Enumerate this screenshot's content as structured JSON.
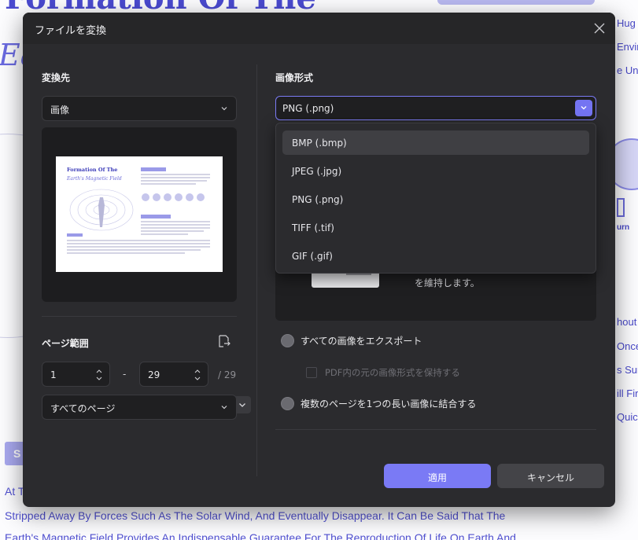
{
  "background": {
    "title": "Formation Of The",
    "italic": "Ea",
    "right_labels": [
      "Hug",
      "Envir",
      "e Uni",
      "hout C",
      "Once",
      "s Surf",
      "ill Fir",
      "Quick"
    ],
    "burn_label": "urn",
    "s_button": "S",
    "lines": [
      "At T",
      "Stripped Away By Forces Such As The Solar Wind, And Eventually Disappear. It Can Be Said That The",
      "Earth's Magnetic Field Provides An Indispensable Guarantee For The Reproduction Of Life On Earth And"
    ]
  },
  "dialog": {
    "title": "ファイルを変換",
    "left": {
      "convert_to_label": "変換先",
      "convert_to_value": "画像",
      "page_range_label": "ページ範囲",
      "page_from": "1",
      "page_to": "29",
      "page_total": "/ 29",
      "range_separator": "-",
      "page_select_value": "すべてのページ"
    },
    "thumbnail": {
      "title1": "Formation Of The",
      "title2": "Earth's Magnetic Field"
    },
    "right": {
      "format_label": "画像形式",
      "format_value": "PNG (.png)",
      "format_options": [
        "BMP (.bmp)",
        "JPEG (.jpg)",
        "PNG (.png)",
        "TIFF (.tif)",
        "GIF (.gif)"
      ],
      "highlighted_option": "BMP (.bmp)",
      "panel_text": "を維持します。",
      "export_all_label": "すべての画像をエクスポート",
      "keep_format_label": "PDF内の元の画像形式を保持する",
      "merge_label": "複数のページを1つの長い画像に結合する"
    },
    "buttons": {
      "apply": "適用",
      "cancel": "キャンセル"
    }
  },
  "colors": {
    "accent": "#7a7af5",
    "dialog_bg": "#2b2b2e",
    "field_bg": "#1f1f21"
  }
}
